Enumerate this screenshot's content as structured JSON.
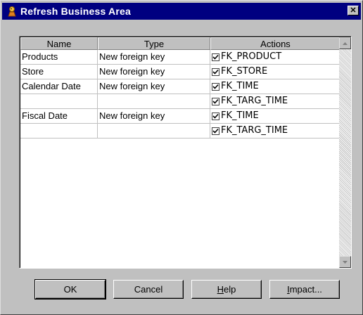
{
  "window": {
    "title": "Refresh Business Area"
  },
  "table": {
    "columns": [
      "Name",
      "Type",
      "Actions"
    ],
    "rows": [
      {
        "name": "Products",
        "type": "New foreign key",
        "action": "FK_PRODUCT",
        "checked": true
      },
      {
        "name": "Store",
        "type": "New foreign key",
        "action": "FK_STORE",
        "checked": true
      },
      {
        "name": "Calendar Date",
        "type": "New foreign key",
        "action": "FK_TIME",
        "checked": true
      },
      {
        "name": "",
        "type": "",
        "action": "FK_TARG_TIME",
        "checked": true
      },
      {
        "name": "Fiscal Date",
        "type": "New foreign key",
        "action": "FK_TIME",
        "checked": true
      },
      {
        "name": "",
        "type": "",
        "action": "FK_TARG_TIME",
        "checked": true
      }
    ]
  },
  "buttons": {
    "ok": "OK",
    "cancel": "Cancel",
    "help_mnemonic": "H",
    "help_rest": "elp",
    "impact_mnemonic": "I",
    "impact_rest": "mpact..."
  },
  "icons": {
    "title": "wizard-icon",
    "close": "close-icon",
    "scroll_up": "arrow-up-icon",
    "scroll_down": "arrow-down-icon",
    "checkbox": "checkmark-icon"
  }
}
